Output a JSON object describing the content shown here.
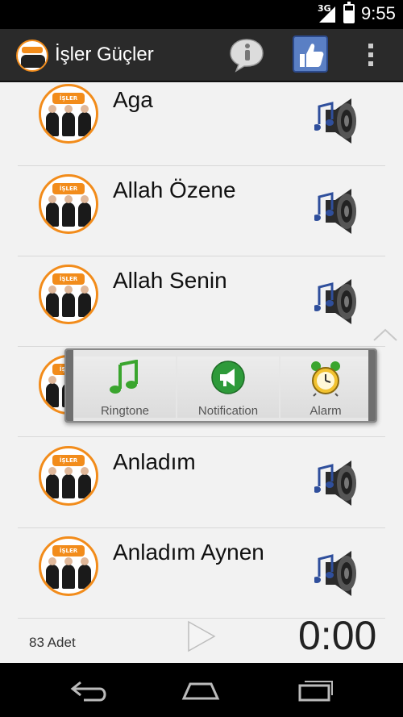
{
  "status_bar": {
    "network": "3G",
    "time": "9:55",
    "battery_level": 0.7
  },
  "action_bar": {
    "title": "İşler Güçler",
    "icons": [
      "app-logo-icon",
      "info-icon",
      "like-icon",
      "overflow-menu-icon"
    ]
  },
  "list": {
    "items": [
      {
        "title": "Aga"
      },
      {
        "title": "Allah Özene"
      },
      {
        "title": "Allah Senin"
      },
      {
        "title": ""
      },
      {
        "title": "Anladım"
      },
      {
        "title": "Anladım Aynen"
      }
    ],
    "avatar_text": "İŞLER GÜÇLER"
  },
  "popup": {
    "options": [
      {
        "label": "Ringtone",
        "icon": "music-note-icon"
      },
      {
        "label": "Notification",
        "icon": "megaphone-icon"
      },
      {
        "label": "Alarm",
        "icon": "alarm-clock-icon"
      }
    ]
  },
  "bottom": {
    "count": "83 Adet",
    "timer": "0:00"
  },
  "nav": {
    "icons": [
      "back-icon",
      "home-icon",
      "recent-apps-icon"
    ]
  },
  "colors": {
    "accent": "#f28c1b",
    "action_bar": "#2a2a2a",
    "list_bg": "#f2f2f2"
  }
}
